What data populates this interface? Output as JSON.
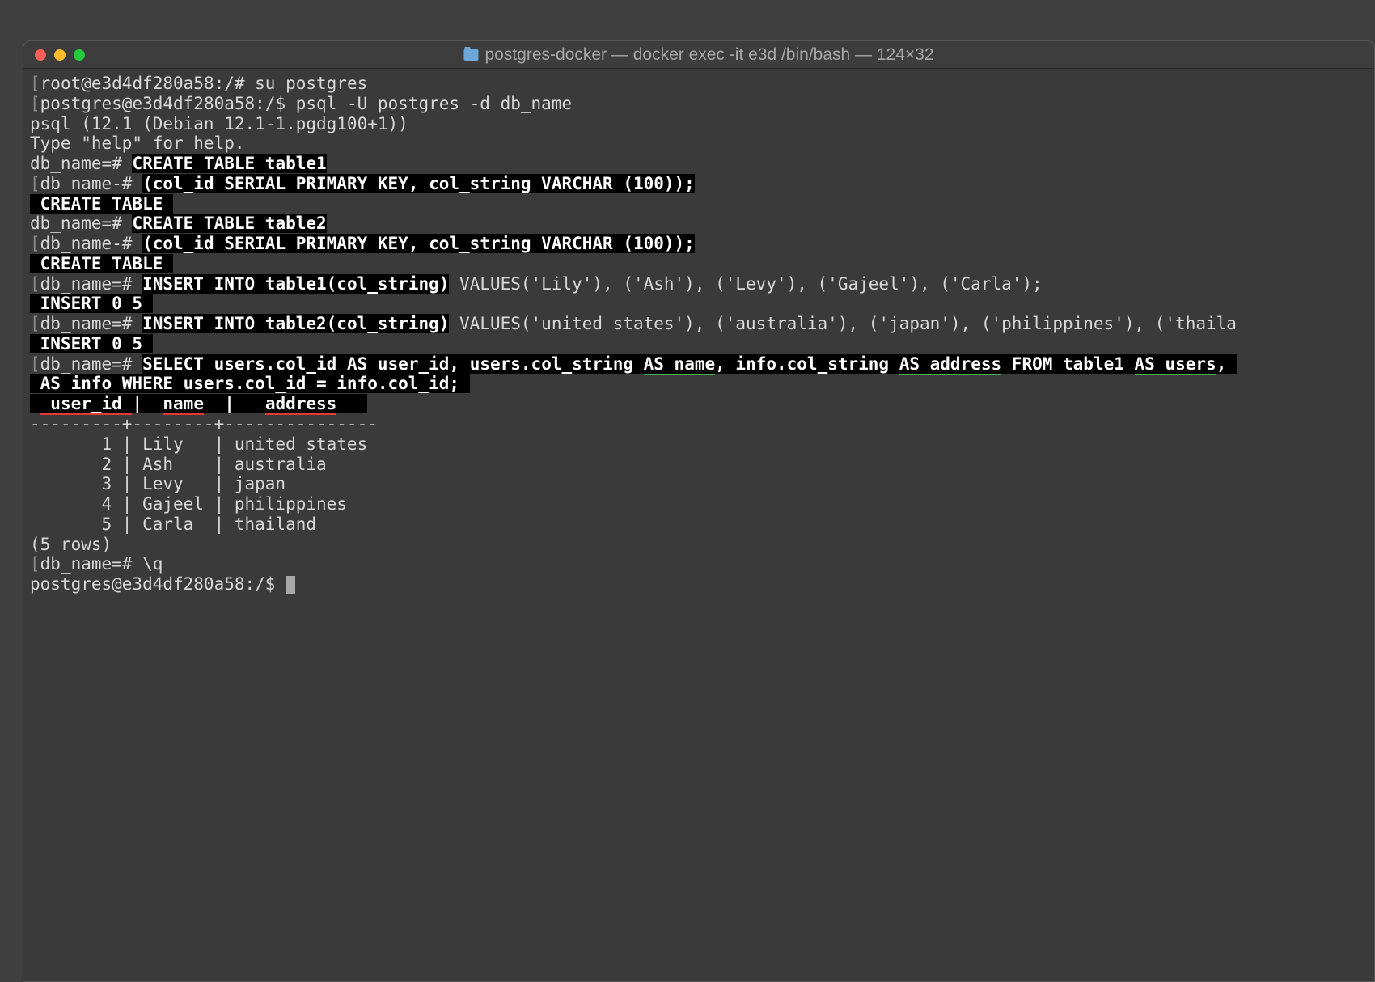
{
  "window": {
    "title": "postgres-docker — docker exec -it e3d /bin/bash — 124×32"
  },
  "lines": {
    "l1_bracket": "[",
    "l1_prompt": "root@e3d4df280a58:/# su postgres",
    "l2_bracket": "[",
    "l2_prompt": "postgres@e3d4df280a58:/$ psql -U postgres -d db_name",
    "l3": "psql (12.1 (Debian 12.1-1.pgdg100+1))",
    "l4": "Type \"help\" for help.",
    "l5": "",
    "l6_prompt": "db_name=# ",
    "l6_hl": "CREATE TABLE table1",
    "l7_bracket": "[",
    "l7_prompt": "db_name-# ",
    "l7_hl": "(col_id SERIAL PRIMARY KEY, col_string VARCHAR (100));",
    "l8_hl": " CREATE TABLE ",
    "l9_prompt": "db_name=# ",
    "l9_hl": "CREATE TABLE table2",
    "l10_bracket": "[",
    "l10_prompt": "db_name-# ",
    "l10_hl": "(col_id SERIAL PRIMARY KEY, col_string VARCHAR (100));",
    "l11_hl": " CREATE TABLE ",
    "l12_bracket": "[",
    "l12_prompt": "db_name=# ",
    "l12_hl": "INSERT INTO table1(col_string)",
    "l12_rest": " VALUES('Lily'), ('Ash'), ('Levy'), ('Gajeel'), ('Carla');",
    "l13_hl": " INSERT 0 5 ",
    "l14_bracket": "[",
    "l14_prompt": "db_name=# ",
    "l14_hl": "INSERT INTO table2(col_string)",
    "l14_rest": " VALUES('united states'), ('australia'), ('japan'), ('philippines'), ('thaila",
    "l15_hl": " INSERT 0 5 ",
    "l16_bracket": "[",
    "l16_prompt": "db_name=# ",
    "l16_s1": "SELECT users.col_id ",
    "l16_u1": "AS user_id",
    "l16_s2": ", users.col_string ",
    "l16_u2": "AS name",
    "l16_s3": ", info.col_string ",
    "l16_u3": "AS address",
    "l16_s4": " FROM table1 ",
    "l16_u4": "AS users",
    "l16_s5": ", ",
    "l17_hl": " AS info WHERE users.col_id = info.col_id; ",
    "l18_pad": " ",
    "l18_c1": " user_id ",
    "l18_sep1": "|  ",
    "l18_c2": "name",
    "l18_sep2": "  |   ",
    "l18_c3": "address",
    "l18_pad2": "   ",
    "l19": "---------+--------+---------------",
    "l20": "       1 | Lily   | united states",
    "l21": "       2 | Ash    | australia",
    "l22": "       3 | Levy   | japan",
    "l23": "       4 | Gajeel | philippines",
    "l24": "       5 | Carla  | thailand",
    "l25": "(5 rows)",
    "l26": "",
    "l27_bracket": "[",
    "l27_prompt": "db_name=# \\q",
    "l28": "postgres@e3d4df280a58:/$ "
  }
}
